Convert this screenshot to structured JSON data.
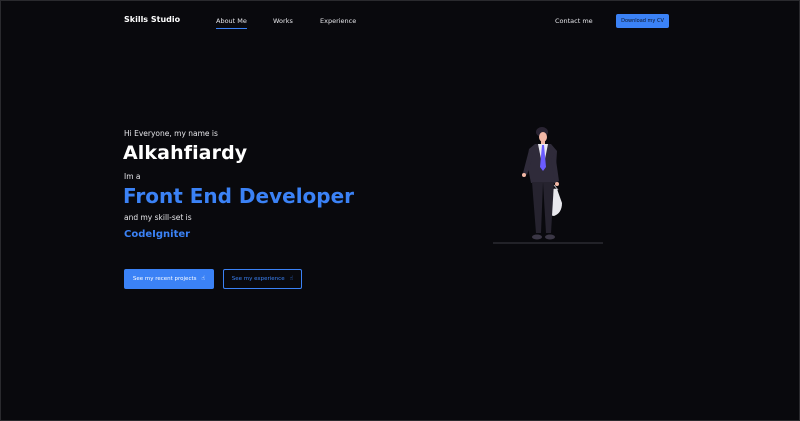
{
  "nav": {
    "brand": "Skills Studio",
    "links": [
      {
        "label": "About Me",
        "active": true
      },
      {
        "label": "Works",
        "active": false
      },
      {
        "label": "Experience",
        "active": false
      }
    ],
    "contact": "Contact me",
    "download_cv": "Download my CV"
  },
  "hero": {
    "greeting": "Hi Everyone, my name is",
    "name": "Alkahfiardy",
    "im_a": "Im a",
    "role": "Front End Developer",
    "skillset_intro": "and my skill-set is",
    "skill": "CodeIgniter"
  },
  "actions": {
    "projects_label": "See my recent projects",
    "experience_label": "See my experience"
  },
  "icons": {
    "projects_icon": "pointer-hand-icon",
    "experience_icon": "pointer-hand-icon"
  },
  "colors": {
    "background": "#09090d",
    "accent": "#3b82f6",
    "text": "#ffffff"
  }
}
